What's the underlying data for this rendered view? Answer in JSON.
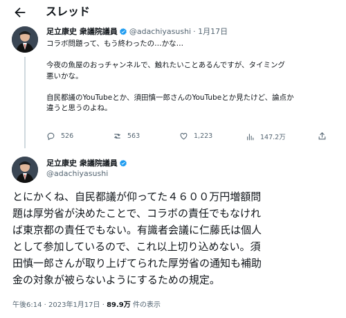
{
  "header": {
    "title": "スレッド",
    "back_icon": "arrow-left-icon"
  },
  "tweet1": {
    "name": "足立康史 衆議院議員",
    "handle": "@adachiyasushi",
    "date": "· 1月17日",
    "lines": [
      "コラボ問題って、もう終わったの…かな…",
      "今夜の魚屋のおっチャンネルで、触れたいことあるんですが、タイミング",
      "悪いかな。",
      "自民都議のYouTubeとか、須田慎一郎さんのYouTubeとか見たけど、論点か",
      "違うと思うのよね。"
    ],
    "actions": {
      "replies": "526",
      "retweets": "563",
      "likes": "1,223",
      "views": "147.2万"
    }
  },
  "tweet2": {
    "name": "足立康史 衆議院議員",
    "handle": "@adachiyasushi",
    "lines": [
      "とにかくね、自民都議が仰ってた４６００万円増額問",
      "題は厚労省が決めたことで、コラボの責任でもなけれ",
      "ば東京都の責任でもない。有識者会議に仁藤氏は個人",
      "として参加しているので、これ以上切り込めない。須",
      "田慎一郎さんが取り上げてられた厚労省の通知も補助",
      "金の対象が被らないようにするための規定。"
    ],
    "time": "午後6:14 · 2023年1月17日 · ",
    "views_count": "89.9万",
    "views_label": " 件の表示"
  },
  "colors": {
    "text": "#0f1419",
    "secondary": "#536471",
    "verified": "#1d9bf0",
    "divider": "#cfd9de"
  }
}
